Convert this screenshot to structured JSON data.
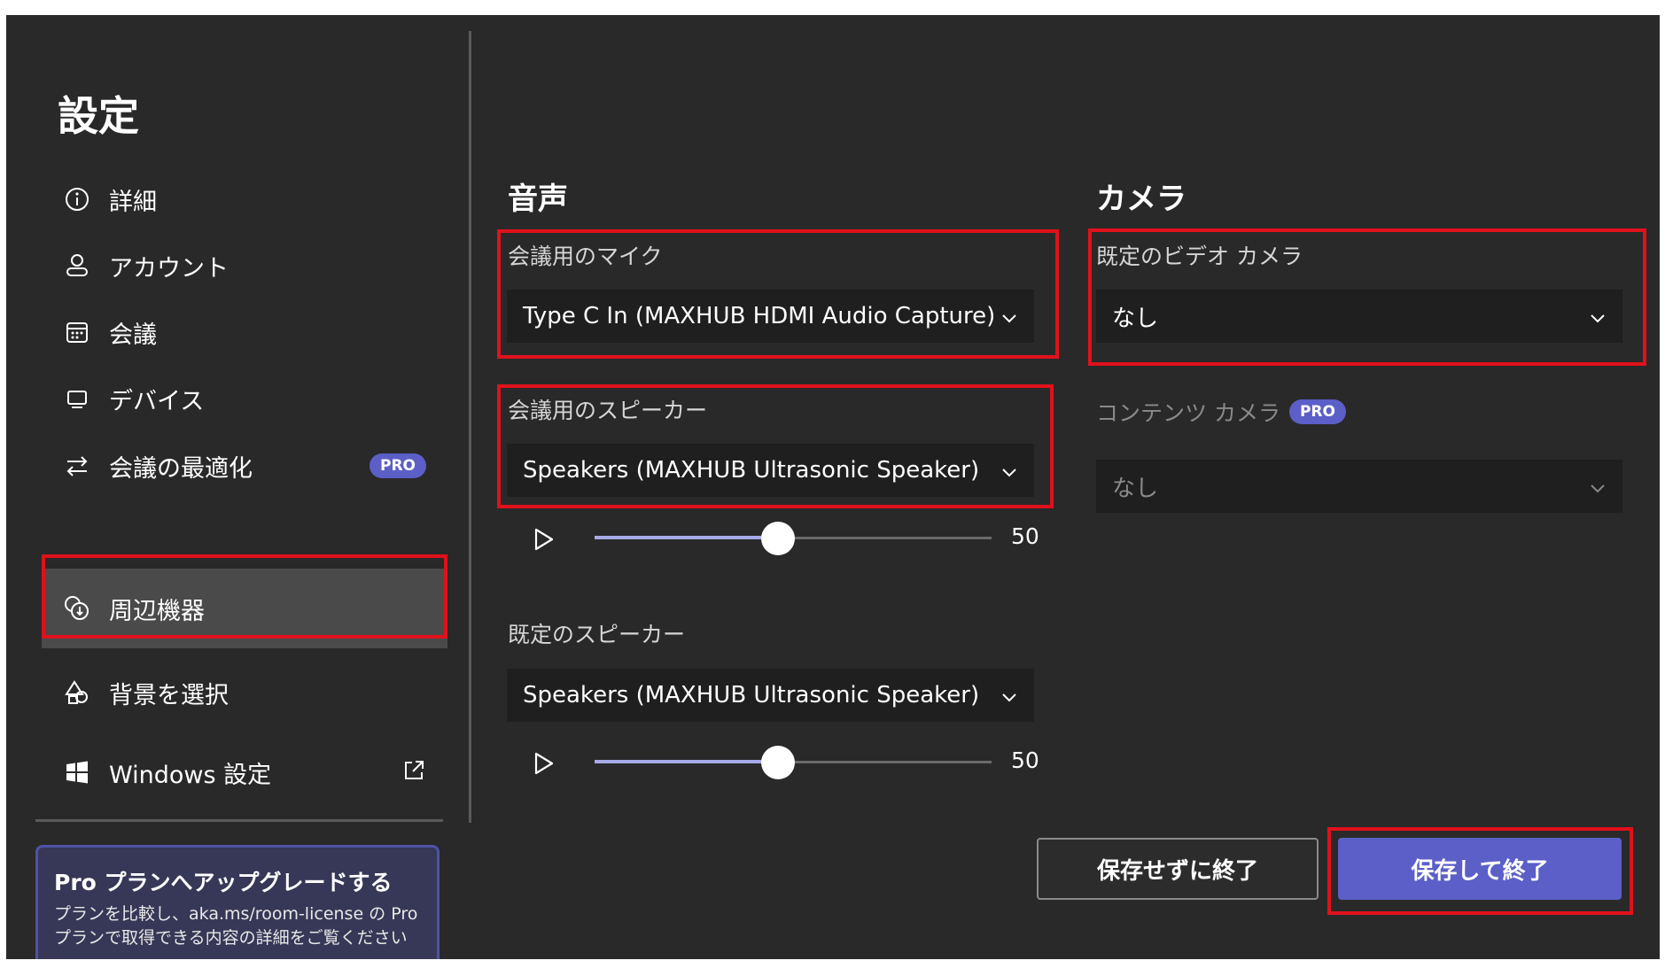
{
  "page": {
    "title": "設定"
  },
  "sidebar": {
    "items": [
      {
        "label": "詳細",
        "icon": "info-icon"
      },
      {
        "label": "アカウント",
        "icon": "account-icon"
      },
      {
        "label": "会議",
        "icon": "calendar-icon"
      },
      {
        "label": "デバイス",
        "icon": "device-icon"
      },
      {
        "label": "会議の最適化",
        "icon": "optimize-arrows-icon",
        "badge": "PRO"
      },
      {
        "label": "周辺機器",
        "icon": "peripherals-icon",
        "selected": true
      },
      {
        "label": "背景を選択",
        "icon": "shapes-icon"
      },
      {
        "label": "Windows 設定",
        "icon": "windows-icon",
        "external": "open-external-icon"
      }
    ],
    "promo": {
      "title": "Pro プランへアップグレードする",
      "description": "プランを比較し、aka.ms/room-license の Pro プランで取得できる内容の詳細をご覧ください"
    }
  },
  "audio": {
    "heading": "音声",
    "mic": {
      "label": "会議用のマイク",
      "value": "Type C In (MAXHUB HDMI Audio Capture)"
    },
    "speaker": {
      "label": "会議用のスピーカー",
      "value": "Speakers (MAXHUB Ultrasonic Speaker)",
      "volume": "50"
    },
    "default_speaker": {
      "label": "既定のスピーカー",
      "value": "Speakers (MAXHUB Ultrasonic Speaker)",
      "volume": "50"
    }
  },
  "camera": {
    "heading": "カメラ",
    "default_video": {
      "label": "既定のビデオ カメラ",
      "value": "なし"
    },
    "content_camera": {
      "label": "コンテンツ カメラ",
      "badge": "PRO",
      "value": "なし",
      "disabled": true
    }
  },
  "footer": {
    "exit_without_save": "保存せずに終了",
    "save_and_exit": "保存して終了"
  },
  "colors": {
    "background": "#292929",
    "accent": "#5b5fc7",
    "highlight_box": "#e0111b",
    "dropdown_bg": "#1f1f1f"
  }
}
